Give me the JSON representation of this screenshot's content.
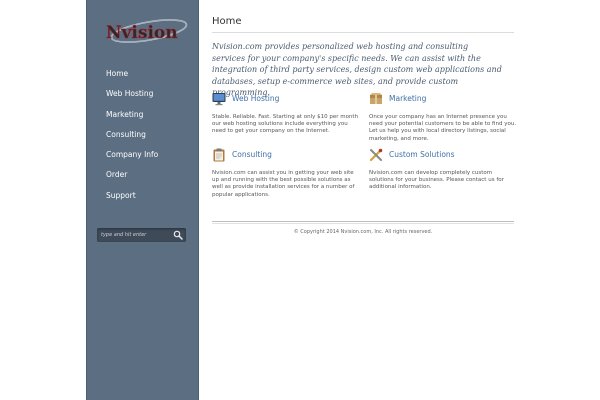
{
  "brand": {
    "logo_text": "Nvision"
  },
  "sidebar": {
    "nav": [
      {
        "label": "Home"
      },
      {
        "label": "Web Hosting"
      },
      {
        "label": "Marketing"
      },
      {
        "label": "Consulting"
      },
      {
        "label": "Company Info"
      },
      {
        "label": "Order"
      },
      {
        "label": "Support"
      }
    ],
    "search": {
      "placeholder": "type and hit enter",
      "icon": "search-icon"
    }
  },
  "main": {
    "title": "Home",
    "intro": "Nvision.com provides personalized web hosting and consulting services for your company's specific needs. We can assist with the integration of third party services, design custom web applications and databases, setup e-commerce web sites, and provide custom programming.",
    "services": [
      {
        "title": "Web Hosting",
        "icon": "monitor-icon",
        "desc": "Stable. Reliable. Fast. Starting at only $10 per month our web hosting solutions include everything you need to get your company on the Internet."
      },
      {
        "title": "Marketing",
        "icon": "box-icon",
        "desc": "Once your company has an Internet presence you need your potential customers to be able to find you. Let us help you with local directory listings, social marketing, and more."
      },
      {
        "title": "Consulting",
        "icon": "clipboard-icon",
        "desc": "Nvision.com can assist you in getting your web site up and running with the best possible solutions as well as provide installation services for a number of popular applications."
      },
      {
        "title": "Custom Solutions",
        "icon": "tools-icon",
        "desc": "Nvision.com can develop completely custom solutions for your business. Please contact us for additional information."
      }
    ]
  },
  "footer": {
    "copyright": "© Copyright 2014 Nvision.com, Inc. All rights reserved."
  },
  "colors": {
    "sidebar_bg": "#5c6e82",
    "link_blue": "#3f6fa5",
    "intro_text": "#4a5b6e",
    "logo_red": "#b0202a"
  }
}
